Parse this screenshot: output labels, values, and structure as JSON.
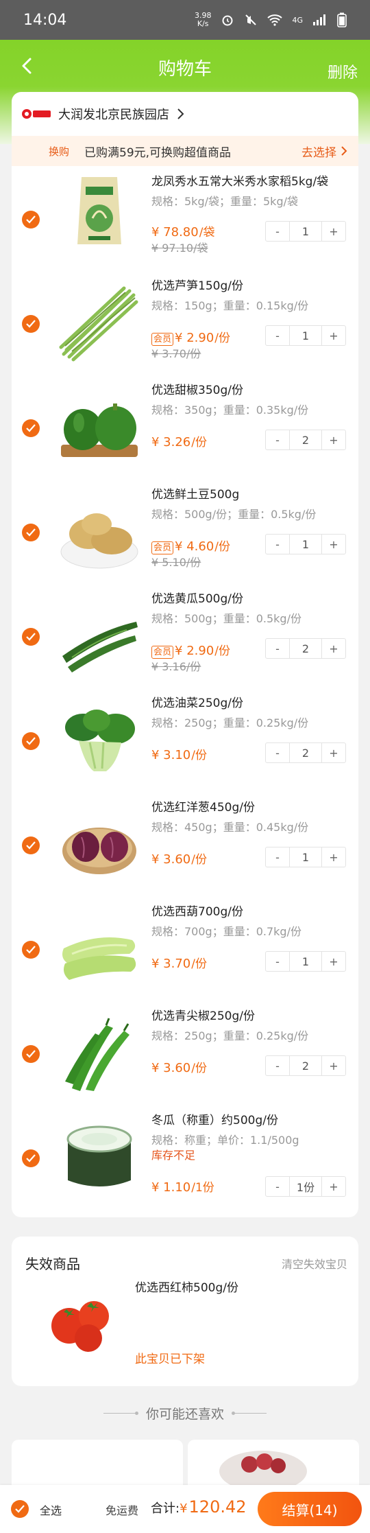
{
  "status_bar": {
    "time": "14:04",
    "net_speed": "3.98\nK/s",
    "signal": "4G"
  },
  "nav": {
    "title": "购物车",
    "delete": "删除"
  },
  "store": {
    "name": "大润发北京民族园店",
    "logo_text": "大润发"
  },
  "promo": {
    "tag": "换购",
    "text": "已购满59元,可换购超值商品",
    "link": "去选择"
  },
  "items": [
    {
      "name": "龙凤秀水五常大米秀水家稻5kg/袋",
      "spec": "规格：5kg/袋；重量：5kg/袋",
      "price": "¥ 78.80",
      "unit": "/袋",
      "old": "¥ 97.10/袋",
      "vip": "",
      "qty": "1",
      "warn": ""
    },
    {
      "name": "优选芦笋150g/份",
      "spec": "规格：150g；重量：0.15kg/份",
      "price": "¥ 2.90",
      "unit": "/份",
      "old": "¥ 3.70/份",
      "vip": "会员",
      "qty": "1",
      "warn": ""
    },
    {
      "name": "优选甜椒350g/份",
      "spec": "规格：350g；重量：0.35kg/份",
      "price": "¥ 3.26",
      "unit": "/份",
      "old": "",
      "vip": "",
      "qty": "2",
      "warn": ""
    },
    {
      "name": "优选鲜土豆500g",
      "spec": "规格：500g/份；重量：0.5kg/份",
      "price": "¥ 4.60",
      "unit": "/份",
      "old": "¥ 5.10/份",
      "vip": "会员",
      "qty": "1",
      "warn": ""
    },
    {
      "name": "优选黄瓜500g/份",
      "spec": "规格：500g；重量：0.5kg/份",
      "price": "¥ 2.90",
      "unit": "/份",
      "old": "¥ 3.16/份",
      "vip": "会员",
      "qty": "2",
      "warn": ""
    },
    {
      "name": "优选油菜250g/份",
      "spec": "规格：250g；重量：0.25kg/份",
      "price": "¥ 3.10",
      "unit": "/份",
      "old": "",
      "vip": "",
      "qty": "2",
      "warn": ""
    },
    {
      "name": "优选红洋葱450g/份",
      "spec": "规格：450g；重量：0.45kg/份",
      "price": "¥ 3.60",
      "unit": "/份",
      "old": "",
      "vip": "",
      "qty": "1",
      "warn": ""
    },
    {
      "name": "优选西葫700g/份",
      "spec": "规格：700g；重量：0.7kg/份",
      "price": "¥ 3.70",
      "unit": "/份",
      "old": "",
      "vip": "",
      "qty": "1",
      "warn": ""
    },
    {
      "name": "优选青尖椒250g/份",
      "spec": "规格：250g；重量：0.25kg/份",
      "price": "¥ 3.60",
      "unit": "/份",
      "old": "",
      "vip": "",
      "qty": "2",
      "warn": ""
    },
    {
      "name": "冬瓜（称重）约500g/份",
      "spec": "规格：称重；单价：1.1/500g",
      "price": "¥ 1.10",
      "unit": "/1份",
      "old": "",
      "vip": "",
      "qty": "1份",
      "warn": "库存不足"
    }
  ],
  "invalid": {
    "title": "失效商品",
    "clear": "清空失效宝贝",
    "item_name": "优选西红柿500g/份",
    "status": "此宝贝已下架"
  },
  "recommend": {
    "title": "你可能还喜欢"
  },
  "bottom": {
    "select_all": "全选",
    "shipping": "免运费",
    "total_label": "合计:",
    "total_symbol": "¥",
    "total_amount": "120.42",
    "checkout": "结算(14)"
  },
  "colors": {
    "brand_green": "#7fd122",
    "accent_orange": "#f06a13"
  }
}
